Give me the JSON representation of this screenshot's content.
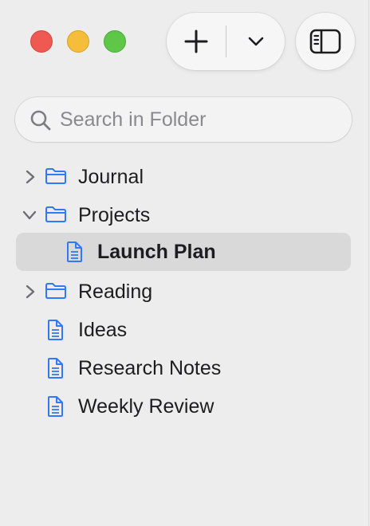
{
  "window": {
    "controls": [
      "close",
      "minimize",
      "zoom"
    ]
  },
  "toolbar": {
    "new_icon": "plus-icon",
    "menu_icon": "chevron-down-icon",
    "sidebar_toggle_icon": "sidebar-icon"
  },
  "search": {
    "placeholder": "Search in Folder",
    "value": ""
  },
  "tree": {
    "items": [
      {
        "label": "Journal",
        "type": "folder",
        "expanded": false,
        "level": 0,
        "selected": false
      },
      {
        "label": "Projects",
        "type": "folder",
        "expanded": true,
        "level": 0,
        "selected": false
      },
      {
        "label": "Launch Plan",
        "type": "document",
        "level": 1,
        "selected": true
      },
      {
        "label": "Reading",
        "type": "folder",
        "expanded": false,
        "level": 0,
        "selected": false
      },
      {
        "label": "Ideas",
        "type": "document",
        "level": 0,
        "selected": false
      },
      {
        "label": "Research Notes",
        "type": "document",
        "level": 0,
        "selected": false
      },
      {
        "label": "Weekly Review",
        "type": "document",
        "level": 0,
        "selected": false
      }
    ]
  },
  "colors": {
    "accent": "#2f7bf5",
    "close": "#ee5a52",
    "minimize": "#f5bd3a",
    "zoom": "#5fc748",
    "selection": "#d9d9d9"
  }
}
